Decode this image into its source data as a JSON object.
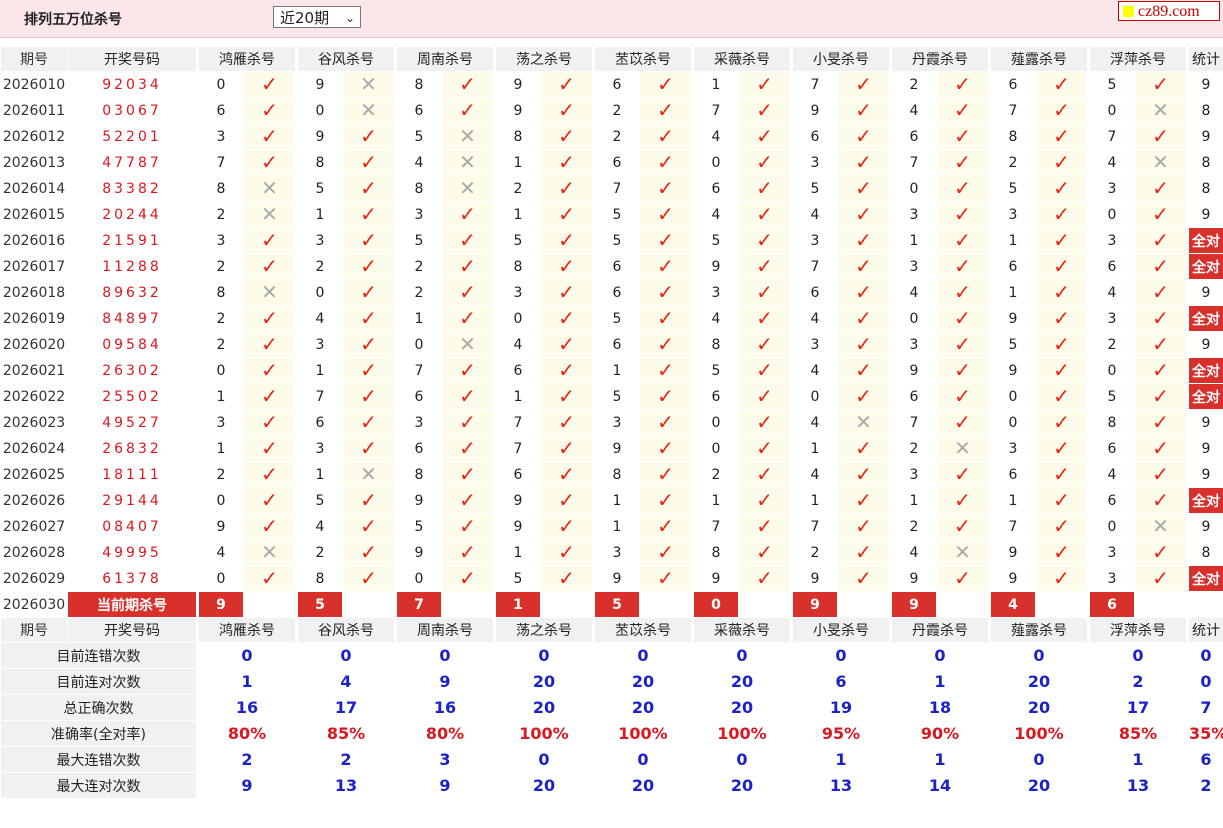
{
  "page": {
    "title": "排列五万位杀号",
    "select_value": "近20期",
    "logo": "cz89.com"
  },
  "columns": {
    "period": "期号",
    "numbers": "开奖号码",
    "experts": [
      "鸿雁杀号",
      "谷风杀号",
      "周南杀号",
      "荡之杀号",
      "苤苡杀号",
      "采薇杀号",
      "小旻杀号",
      "丹霞杀号",
      "薤露杀号",
      "浮萍杀号"
    ],
    "stat": "统计"
  },
  "rows": [
    {
      "period": "2026010",
      "numbers": "92034",
      "kills": [
        0,
        9,
        8,
        9,
        6,
        1,
        7,
        2,
        6,
        5
      ],
      "ok": [
        1,
        0,
        1,
        1,
        1,
        1,
        1,
        1,
        1,
        1
      ],
      "stat": "9"
    },
    {
      "period": "2026011",
      "numbers": "03067",
      "kills": [
        6,
        0,
        6,
        9,
        2,
        7,
        9,
        4,
        7,
        0
      ],
      "ok": [
        1,
        0,
        1,
        1,
        1,
        1,
        1,
        1,
        1,
        0
      ],
      "stat": "8"
    },
    {
      "period": "2026012",
      "numbers": "52201",
      "kills": [
        3,
        9,
        5,
        8,
        2,
        4,
        6,
        6,
        8,
        7
      ],
      "ok": [
        1,
        1,
        0,
        1,
        1,
        1,
        1,
        1,
        1,
        1
      ],
      "stat": "9"
    },
    {
      "period": "2026013",
      "numbers": "47787",
      "kills": [
        7,
        8,
        4,
        1,
        6,
        0,
        3,
        7,
        2,
        4
      ],
      "ok": [
        1,
        1,
        0,
        1,
        1,
        1,
        1,
        1,
        1,
        0
      ],
      "stat": "8"
    },
    {
      "period": "2026014",
      "numbers": "83382",
      "kills": [
        8,
        5,
        8,
        2,
        7,
        6,
        5,
        0,
        5,
        3
      ],
      "ok": [
        0,
        1,
        0,
        1,
        1,
        1,
        1,
        1,
        1,
        1
      ],
      "stat": "8"
    },
    {
      "period": "2026015",
      "numbers": "20244",
      "kills": [
        2,
        1,
        3,
        1,
        5,
        4,
        4,
        3,
        3,
        0
      ],
      "ok": [
        0,
        1,
        1,
        1,
        1,
        1,
        1,
        1,
        1,
        1
      ],
      "stat": "9"
    },
    {
      "period": "2026016",
      "numbers": "21591",
      "kills": [
        3,
        3,
        5,
        5,
        5,
        5,
        3,
        1,
        1,
        3
      ],
      "ok": [
        1,
        1,
        1,
        1,
        1,
        1,
        1,
        1,
        1,
        1
      ],
      "stat": "全对"
    },
    {
      "period": "2026017",
      "numbers": "11288",
      "kills": [
        2,
        2,
        2,
        8,
        6,
        9,
        7,
        3,
        6,
        6
      ],
      "ok": [
        1,
        1,
        1,
        1,
        1,
        1,
        1,
        1,
        1,
        1
      ],
      "stat": "全对"
    },
    {
      "period": "2026018",
      "numbers": "89632",
      "kills": [
        8,
        0,
        2,
        3,
        6,
        3,
        6,
        4,
        1,
        4
      ],
      "ok": [
        0,
        1,
        1,
        1,
        1,
        1,
        1,
        1,
        1,
        1
      ],
      "stat": "9"
    },
    {
      "period": "2026019",
      "numbers": "84897",
      "kills": [
        2,
        4,
        1,
        0,
        5,
        4,
        4,
        0,
        9,
        3
      ],
      "ok": [
        1,
        1,
        1,
        1,
        1,
        1,
        1,
        1,
        1,
        1
      ],
      "stat": "全对"
    },
    {
      "period": "2026020",
      "numbers": "09584",
      "kills": [
        2,
        3,
        0,
        4,
        6,
        8,
        3,
        3,
        5,
        2
      ],
      "ok": [
        1,
        1,
        0,
        1,
        1,
        1,
        1,
        1,
        1,
        1
      ],
      "stat": "9"
    },
    {
      "period": "2026021",
      "numbers": "26302",
      "kills": [
        0,
        1,
        7,
        6,
        1,
        5,
        4,
        9,
        9,
        0
      ],
      "ok": [
        1,
        1,
        1,
        1,
        1,
        1,
        1,
        1,
        1,
        1
      ],
      "stat": "全对"
    },
    {
      "period": "2026022",
      "numbers": "25502",
      "kills": [
        1,
        7,
        6,
        1,
        5,
        6,
        0,
        6,
        0,
        5
      ],
      "ok": [
        1,
        1,
        1,
        1,
        1,
        1,
        1,
        1,
        1,
        1
      ],
      "stat": "全对"
    },
    {
      "period": "2026023",
      "numbers": "49527",
      "kills": [
        3,
        6,
        3,
        7,
        3,
        0,
        4,
        7,
        0,
        8
      ],
      "ok": [
        1,
        1,
        1,
        1,
        1,
        1,
        0,
        1,
        1,
        1
      ],
      "stat": "9"
    },
    {
      "period": "2026024",
      "numbers": "26832",
      "kills": [
        1,
        3,
        6,
        7,
        9,
        0,
        1,
        2,
        3,
        6
      ],
      "ok": [
        1,
        1,
        1,
        1,
        1,
        1,
        1,
        0,
        1,
        1
      ],
      "stat": "9"
    },
    {
      "period": "2026025",
      "numbers": "18111",
      "kills": [
        2,
        1,
        8,
        6,
        8,
        2,
        4,
        3,
        6,
        4
      ],
      "ok": [
        1,
        0,
        1,
        1,
        1,
        1,
        1,
        1,
        1,
        1
      ],
      "stat": "9"
    },
    {
      "period": "2026026",
      "numbers": "29144",
      "kills": [
        0,
        5,
        9,
        9,
        1,
        1,
        1,
        1,
        1,
        6
      ],
      "ok": [
        1,
        1,
        1,
        1,
        1,
        1,
        1,
        1,
        1,
        1
      ],
      "stat": "全对"
    },
    {
      "period": "2026027",
      "numbers": "08407",
      "kills": [
        9,
        4,
        5,
        9,
        1,
        7,
        7,
        2,
        7,
        0
      ],
      "ok": [
        1,
        1,
        1,
        1,
        1,
        1,
        1,
        1,
        1,
        0
      ],
      "stat": "9"
    },
    {
      "period": "2026028",
      "numbers": "49995",
      "kills": [
        4,
        2,
        9,
        1,
        3,
        8,
        2,
        4,
        9,
        3
      ],
      "ok": [
        0,
        1,
        1,
        1,
        1,
        1,
        1,
        0,
        1,
        1
      ],
      "stat": "8"
    },
    {
      "period": "2026029",
      "numbers": "61378",
      "kills": [
        0,
        8,
        0,
        5,
        9,
        9,
        9,
        9,
        9,
        3
      ],
      "ok": [
        1,
        1,
        1,
        1,
        1,
        1,
        1,
        1,
        1,
        1
      ],
      "stat": "全对"
    }
  ],
  "current": {
    "period": "2026030",
    "label": "当前期杀号",
    "kills": [
      "9",
      "5",
      "7",
      "1",
      "5",
      "0",
      "9",
      "9",
      "4",
      "6"
    ]
  },
  "stats": [
    {
      "label": "目前连错次数",
      "values": [
        "0",
        "0",
        "0",
        "0",
        "0",
        "0",
        "0",
        "0",
        "0",
        "0"
      ],
      "stat": "0",
      "color": "blue"
    },
    {
      "label": "目前连对次数",
      "values": [
        "1",
        "4",
        "9",
        "20",
        "20",
        "20",
        "6",
        "1",
        "20",
        "2"
      ],
      "stat": "0",
      "color": "blue"
    },
    {
      "label": "总正确次数",
      "values": [
        "16",
        "17",
        "16",
        "20",
        "20",
        "20",
        "19",
        "18",
        "20",
        "17"
      ],
      "stat": "7",
      "color": "blue"
    },
    {
      "label": "准确率(全对率)",
      "values": [
        "80%",
        "85%",
        "80%",
        "100%",
        "100%",
        "100%",
        "95%",
        "90%",
        "100%",
        "85%"
      ],
      "stat": "35%",
      "color": "red"
    },
    {
      "label": "最大连错次数",
      "values": [
        "2",
        "2",
        "3",
        "0",
        "0",
        "0",
        "1",
        "1",
        "0",
        "1"
      ],
      "stat": "6",
      "color": "blue"
    },
    {
      "label": "最大连对次数",
      "values": [
        "9",
        "13",
        "9",
        "20",
        "20",
        "20",
        "13",
        "14",
        "20",
        "13"
      ],
      "stat": "2",
      "color": "blue"
    }
  ],
  "colors": {
    "accent_red": "#d8312b",
    "header_bg": "#fbe7ea",
    "stat_blue": "#1b22c8",
    "icon_bg": "#fdfbea"
  },
  "icons": {
    "correct": "check-icon",
    "wrong": "cross-icon"
  }
}
